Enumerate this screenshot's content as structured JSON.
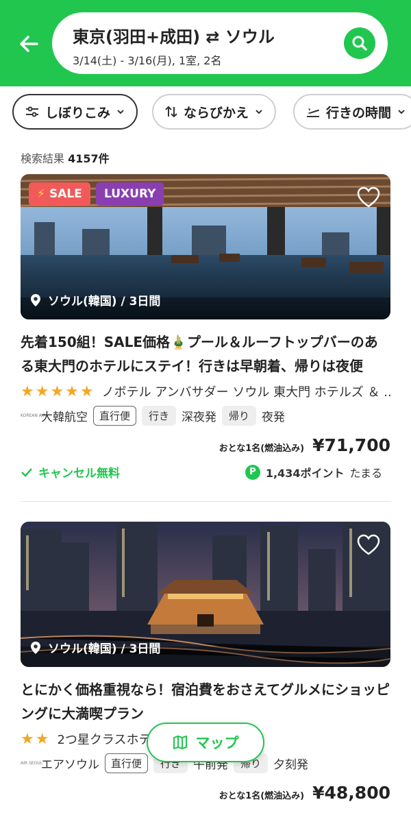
{
  "header": {
    "route": "東京(羽田+成田) ⇄ ソウル",
    "dates": "3/14(土) - 3/16(月), 1室, 2名"
  },
  "filters": [
    {
      "label": "しぼりこみ"
    },
    {
      "label": "ならびかえ"
    },
    {
      "label": "行きの時間"
    }
  ],
  "results": {
    "label": "検索結果",
    "count": "4157件"
  },
  "cards": [
    {
      "badges": [
        "SALE",
        "LUXURY"
      ],
      "location": "ソウル(韓国) / 3日間",
      "title": "先着150組！SALE価格🎍プール＆ルーフトップバーのある東大門のホテルにステイ！行きは早朝着、帰りは夜便",
      "stars": "★★★★★",
      "hotel": "ノボテル アンバサダー ソウル 東大門 ホテルズ ＆ ...",
      "airline_logo_text": "KOREAN AIR",
      "airline": "大韓航空",
      "direct": "直行便",
      "out_label": "行き",
      "out_time": "深夜発",
      "ret_label": "帰り",
      "ret_time": "夜発",
      "price_label": "おとな1名(燃油込み)",
      "price": "¥71,700",
      "cancel": "キャンセル無料",
      "points": "1,434ポイント",
      "points_suffix": "たまる"
    },
    {
      "location": "ソウル(韓国) / 3日間",
      "title": "とにかく価格重視なら！宿泊費をおさえてグルメにショッピングに大満喫プラン",
      "stars": "★★",
      "hotel": "2つ星クラスホテル",
      "airline_logo_text": "AIR SEOUL",
      "airline": "エアソウル",
      "direct": "直行便",
      "out_label": "行き",
      "out_time": "午前発",
      "ret_label": "帰り",
      "ret_time": "夕刻発",
      "price_label": "おとな1名(燃油込み)",
      "price": "¥48,800"
    }
  ],
  "map_button": "マップ",
  "colors": {
    "brand_green": "#21c64f",
    "sale_badge": "#f25a5a",
    "luxury_badge": "#8a3fb0",
    "star": "#f5a623"
  }
}
